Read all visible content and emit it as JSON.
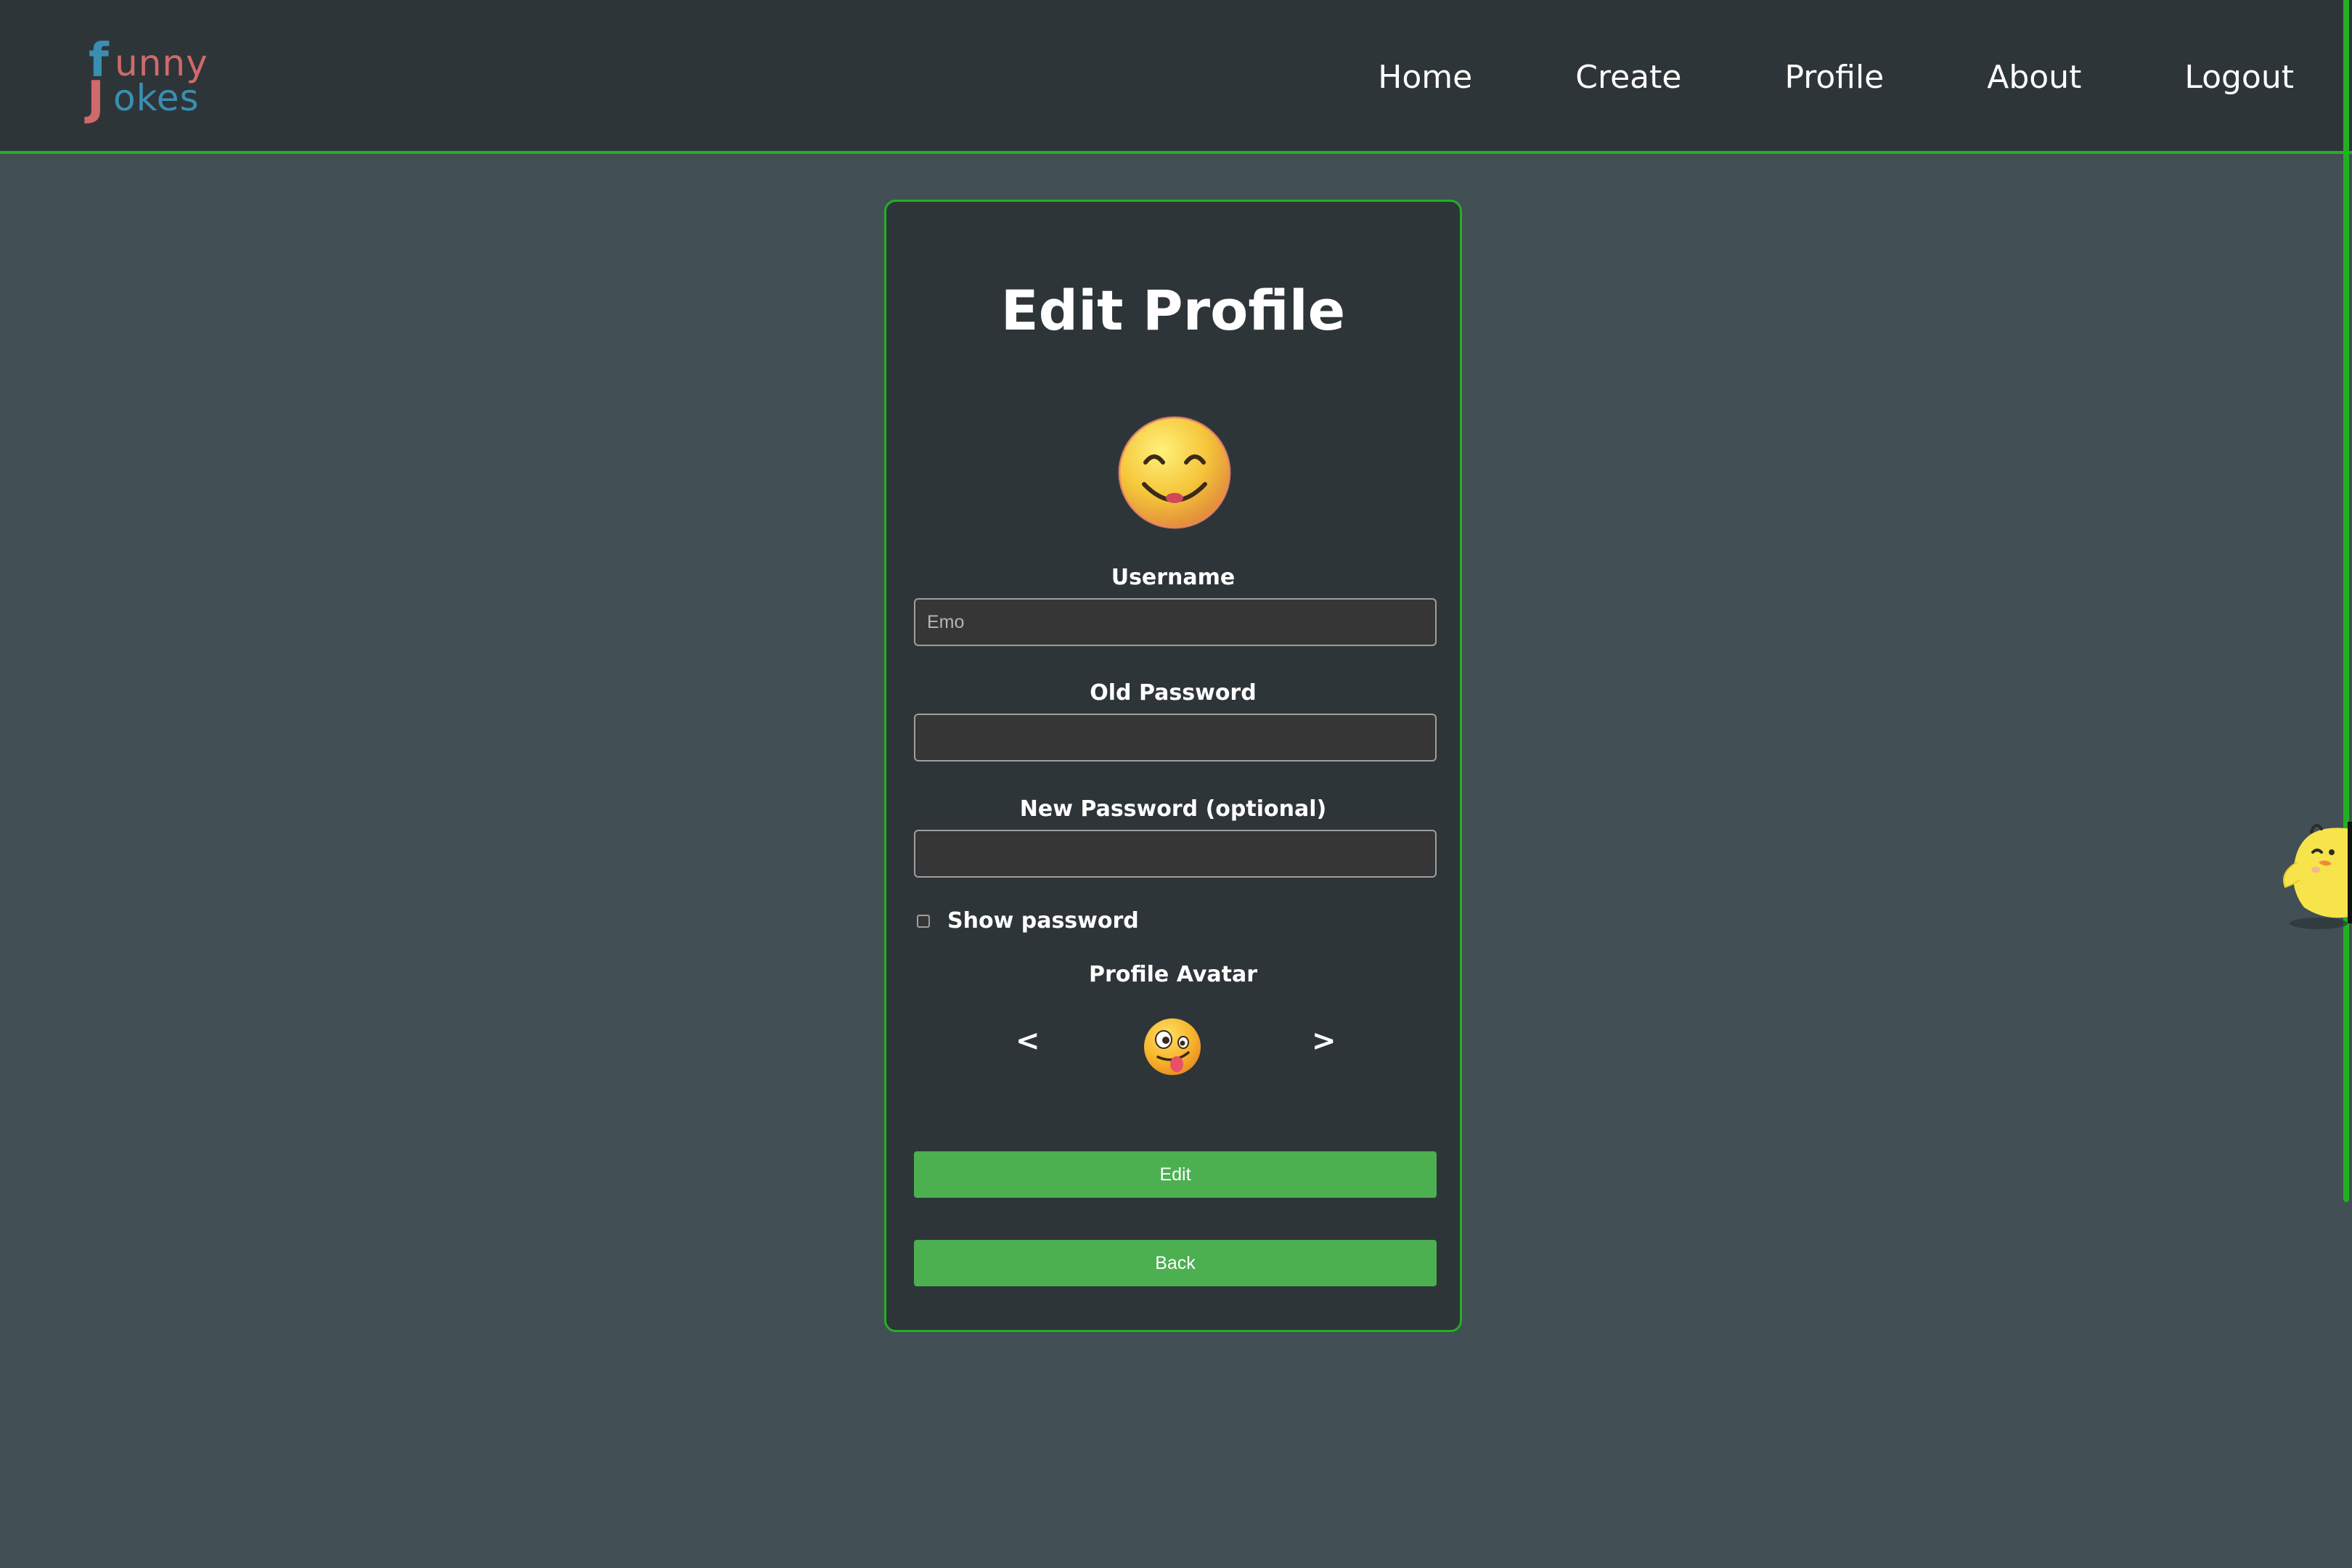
{
  "header": {
    "logo": {
      "big_f": "f",
      "unny": "unny",
      "big_j": "J",
      "okes": "okes"
    },
    "nav": {
      "home": "Home",
      "create": "Create",
      "profile": "Profile",
      "about": "About",
      "logout": "Logout"
    }
  },
  "form": {
    "title": "Edit Profile",
    "current_avatar_icon": "smiling-face-emoji",
    "username_label": "Username",
    "username_placeholder": "Emo",
    "old_password_label": "Old Password",
    "new_password_label": "New Password (optional)",
    "show_password_label": "Show password",
    "show_password_checked": false,
    "avatar_label": "Profile Avatar",
    "prev_arrow": "<",
    "next_arrow": ">",
    "avatar_choice_icon": "zany-face-emoji",
    "edit_button": "Edit",
    "back_button": "Back"
  },
  "colors": {
    "page_bg": "#424f55",
    "panel_bg": "#2e3539",
    "accent_border": "#22b022",
    "button_bg": "#4caf50",
    "logo_blue": "#3a8fb0",
    "logo_red": "#d06a6a"
  }
}
